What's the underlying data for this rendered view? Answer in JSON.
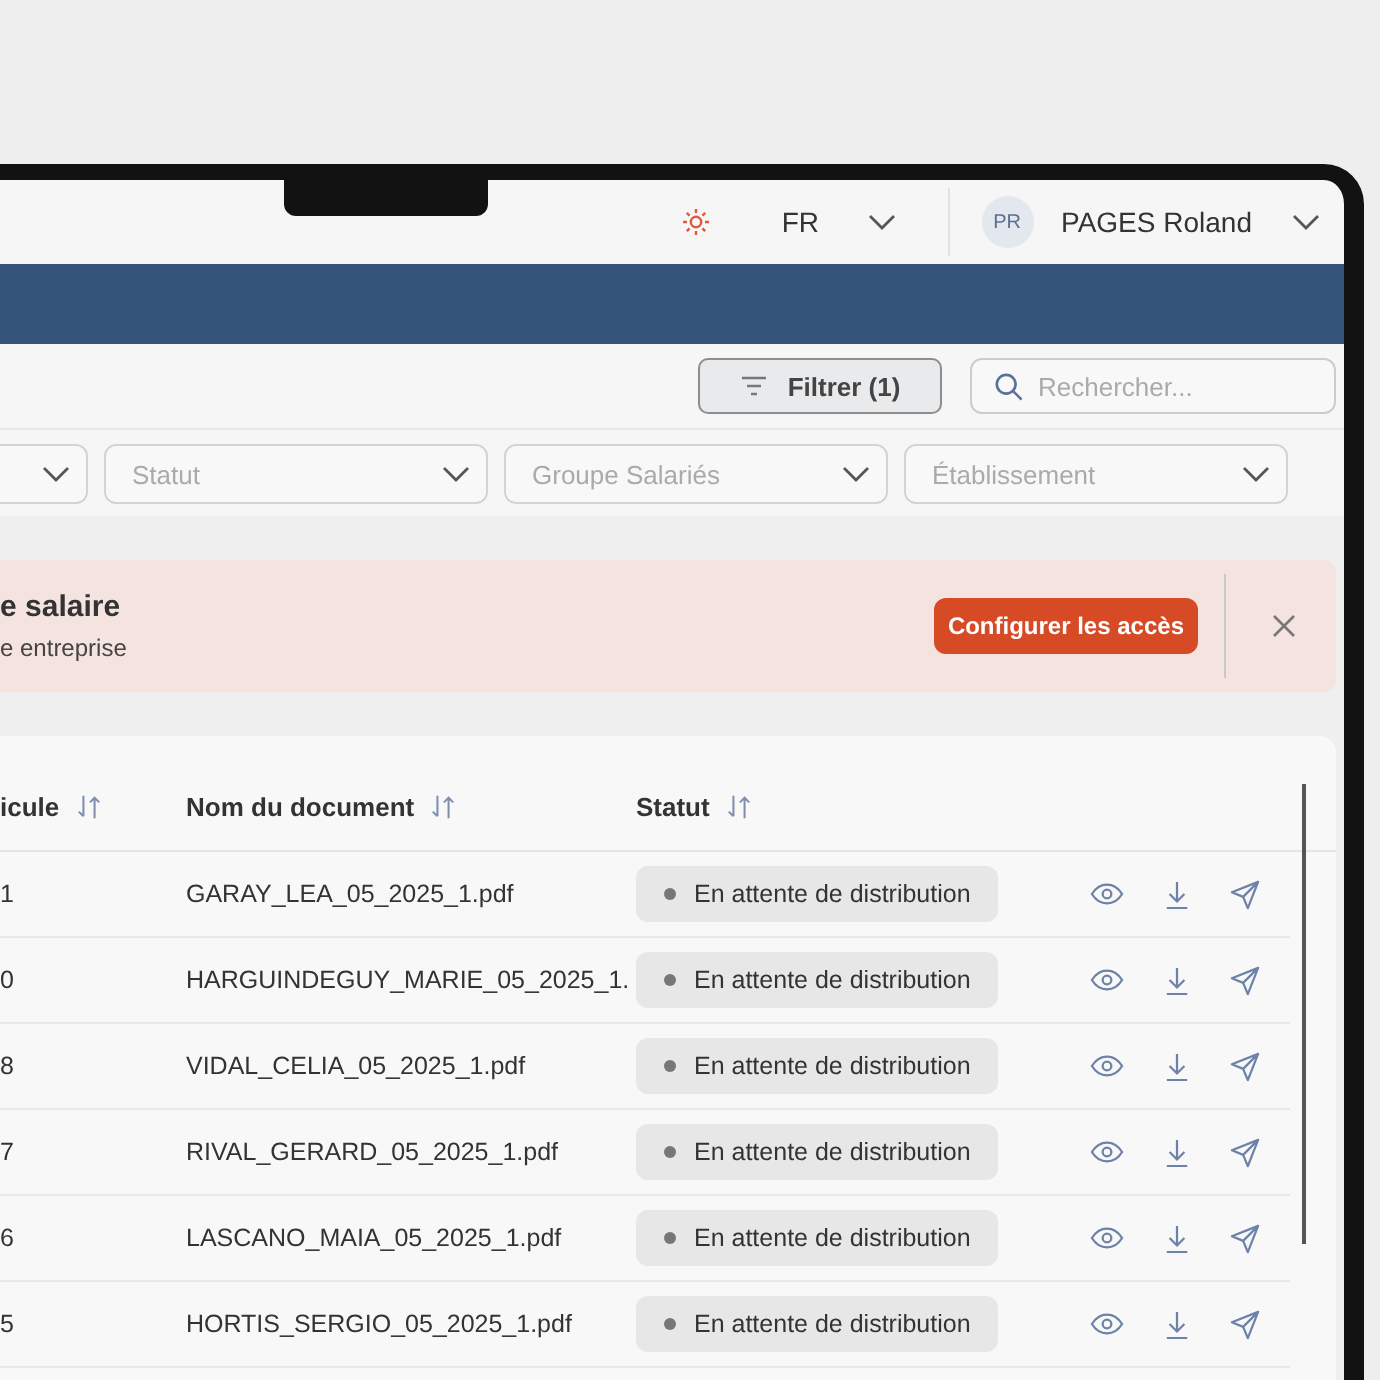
{
  "header": {
    "language": "FR",
    "user": {
      "initials": "PR",
      "name": "PAGES Roland"
    }
  },
  "toolbar": {
    "filter_button": "Filtrer (1)",
    "search": {
      "placeholder": "Rechercher..."
    }
  },
  "filters": [
    {
      "placeholder": "Statut"
    },
    {
      "placeholder": "Groupe Salariés"
    },
    {
      "placeholder": "Établissement"
    }
  ],
  "banner": {
    "title": "e salaire",
    "text": "e entreprise",
    "action": "Configurer les accès"
  },
  "table": {
    "columns": [
      {
        "label": "icule"
      },
      {
        "label": "Nom du document"
      },
      {
        "label": "Statut"
      }
    ],
    "rows": [
      {
        "column_1": "1",
        "document": "GARAY_LEA_05_2025_1.pdf",
        "status": "En attente de distribution"
      },
      {
        "column_1": "0",
        "document": "HARGUINDEGUY_MARIE_05_2025_1.",
        "status": "En attente de distribution"
      },
      {
        "column_1": "8",
        "document": "VIDAL_CELIA_05_2025_1.pdf",
        "status": "En attente de distribution"
      },
      {
        "column_1": "7",
        "document": "RIVAL_GERARD_05_2025_1.pdf",
        "status": "En attente de distribution"
      },
      {
        "column_1": "6",
        "document": "LASCANO_MAIA_05_2025_1.pdf",
        "status": "En attente de distribution"
      },
      {
        "column_1": "5",
        "document": "HORTIS_SERGIO_05_2025_1.pdf",
        "status": "En attente de distribution"
      }
    ]
  }
}
